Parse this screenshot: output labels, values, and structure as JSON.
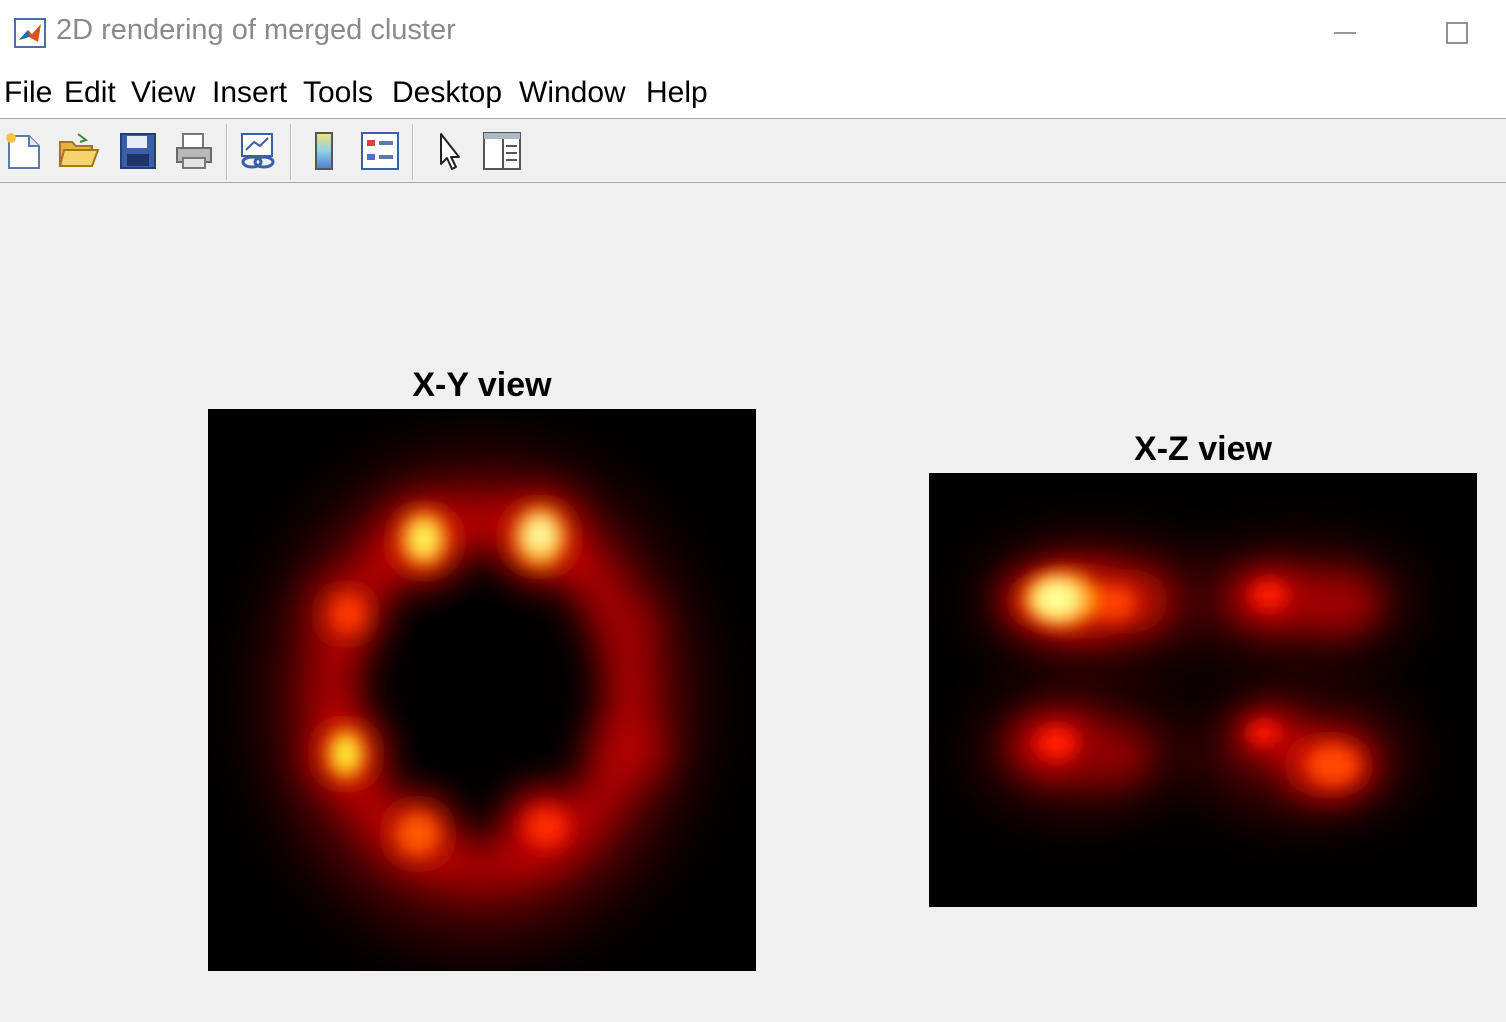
{
  "window": {
    "title": "2D rendering of merged cluster",
    "app_icon": "matlab-logo-icon",
    "controls": [
      "minimize-icon",
      "maximize-icon"
    ]
  },
  "menu": {
    "items": [
      {
        "label": "File"
      },
      {
        "label": "Edit"
      },
      {
        "label": "View"
      },
      {
        "label": "Insert"
      },
      {
        "label": "Tools"
      },
      {
        "label": "Desktop"
      },
      {
        "label": "Window"
      },
      {
        "label": "Help"
      }
    ]
  },
  "toolbar": {
    "buttons": [
      {
        "name": "new-figure",
        "icon": "new-file-icon"
      },
      {
        "name": "open-file",
        "icon": "folder-open-icon"
      },
      {
        "name": "save-figure",
        "icon": "save-disk-icon"
      },
      {
        "name": "print-figure",
        "icon": "printer-icon"
      },
      {
        "name": "link-plot",
        "icon": "link-plot-icon"
      },
      {
        "name": "insert-colorbar",
        "icon": "colorbar-icon"
      },
      {
        "name": "insert-legend",
        "icon": "legend-icon"
      },
      {
        "name": "edit-plot",
        "icon": "pointer-arrow-icon"
      },
      {
        "name": "property-inspector",
        "icon": "property-panel-icon"
      }
    ]
  },
  "axes": [
    {
      "title": "X-Y view",
      "colormap": "hot"
    },
    {
      "title": "X-Z view",
      "colormap": "hot"
    }
  ],
  "colors": {
    "window_bg": "#f0f0f0",
    "titlebar_bg": "#ffffff",
    "title_text": "#8a8a8a",
    "plot_bg": "#000000"
  }
}
